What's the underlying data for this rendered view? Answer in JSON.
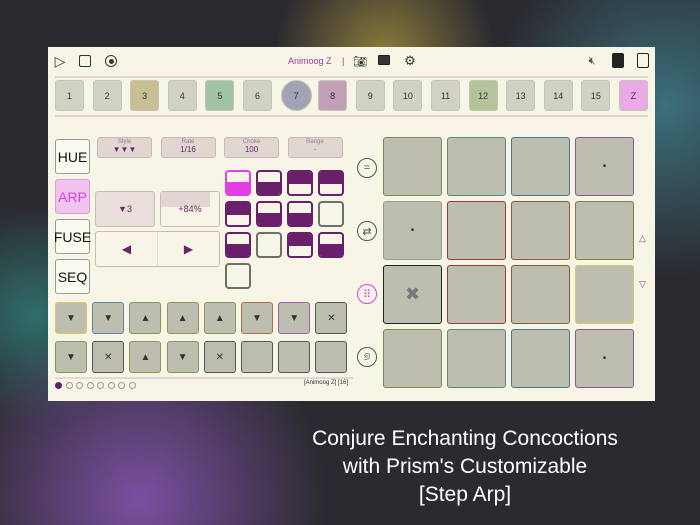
{
  "toolbar": {
    "title": "Animoog Z",
    "separator": "|"
  },
  "tracks": [
    {
      "label": "1",
      "color": "#d2d2c4"
    },
    {
      "label": "2",
      "color": "#d2d2c4"
    },
    {
      "label": "3",
      "color": "#c8bf95"
    },
    {
      "label": "4",
      "color": "#d2d2c4"
    },
    {
      "label": "5",
      "color": "#a1c2a4"
    },
    {
      "label": "6",
      "color": "#d2d2c4"
    },
    {
      "label": "7",
      "color": "#a2a4b5",
      "shape": "circle"
    },
    {
      "label": "8",
      "color": "#c39fb8"
    },
    {
      "label": "9",
      "color": "#d2d2c4"
    },
    {
      "label": "10",
      "color": "#d2d2c4"
    },
    {
      "label": "11",
      "color": "#d2d2c4"
    },
    {
      "label": "12",
      "color": "#b5c39a"
    },
    {
      "label": "13",
      "color": "#d2d2c4"
    },
    {
      "label": "14",
      "color": "#d2d2c4"
    },
    {
      "label": "15",
      "color": "#d2d2c4"
    },
    {
      "label": "Z",
      "color": "#eaaae5"
    }
  ],
  "modes": [
    {
      "label": "HUE"
    },
    {
      "label": "ARP",
      "active": true
    },
    {
      "label": "FUSE"
    },
    {
      "label": "SEQ"
    }
  ],
  "params": [
    {
      "label": "Style",
      "value": "▼▼▼"
    },
    {
      "label": "Rate",
      "value": "1/16"
    },
    {
      "label": "Choke",
      "value": "100"
    },
    {
      "label": "Range",
      "value": "·"
    }
  ],
  "octave": "▼3",
  "gate_percent": "+84%",
  "gate_fraction": 0.84,
  "arrows": {
    "left": "◀",
    "right": "▶"
  },
  "pattern": [
    "bottom-mag",
    "bottom",
    "top",
    "top",
    "top",
    "bottom",
    "bottom",
    "empty",
    "bottom",
    "empty",
    "top",
    "bottom",
    "empty"
  ],
  "steps": [
    [
      {
        "g": "▼",
        "c": "#e0c860"
      },
      {
        "g": "▼",
        "c": "#5a8aa0"
      },
      {
        "g": "▲",
        "c": "#7a9a60"
      },
      {
        "g": "▲",
        "c": "#a09050"
      },
      {
        "g": "▲",
        "c": "#7a9a60"
      },
      {
        "g": "▼",
        "c": "#b07050"
      },
      {
        "g": "▼",
        "c": "#a060b0"
      },
      {
        "g": "✕",
        "c": "#555"
      }
    ],
    [
      {
        "g": "▼",
        "c": "#7a9a60"
      },
      {
        "g": "✕",
        "c": "#555"
      },
      {
        "g": "▲",
        "c": "#a09050"
      },
      {
        "g": "▼",
        "c": "#7a9a60"
      },
      {
        "g": "✕",
        "c": "#555"
      },
      {
        "g": "",
        "c": "#555"
      },
      {
        "g": "",
        "c": "#555"
      },
      {
        "g": "",
        "c": "#555"
      }
    ]
  ],
  "page_dots": 8,
  "status": "[Animoog Z] [16]",
  "grid": [
    [
      {
        "g": "",
        "c": "#7a8a50"
      },
      {
        "g": "",
        "c": "#5a8a7a"
      },
      {
        "g": "",
        "c": "#4a7a8a"
      },
      {
        "g": "•",
        "c": "#8a5a9a"
      }
    ],
    [
      {
        "g": "•",
        "c": "#999"
      },
      {
        "g": "",
        "c": "#9a3a40"
      },
      {
        "g": "",
        "c": "#8a5a40"
      },
      {
        "g": "",
        "c": "#8a7a40"
      }
    ],
    [
      {
        "g": "✖",
        "c": "#222"
      },
      {
        "g": "",
        "c": "#9a3a40"
      },
      {
        "g": "",
        "c": "#8a5a40"
      },
      {
        "g": "",
        "c": "#e0c860"
      }
    ],
    [
      {
        "g": "",
        "c": "#7a8a50"
      },
      {
        "g": "",
        "c": "#5a8a7a"
      },
      {
        "g": "",
        "c": "#4a7a8a"
      },
      {
        "g": "•",
        "c": "#8a5a9a"
      }
    ]
  ],
  "caption": [
    "Conjure Enchanting Concoctions",
    "with Prism's Customizable",
    "[Step Arp]"
  ]
}
